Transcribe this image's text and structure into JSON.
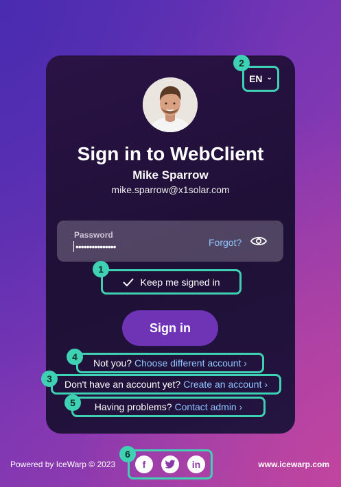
{
  "language": {
    "code": "EN"
  },
  "markers": [
    "1",
    "2",
    "3",
    "4",
    "5",
    "6"
  ],
  "heading": {
    "title": "Sign in to WebClient"
  },
  "user": {
    "name": "Mike Sparrow",
    "email": "mike.sparrow@x1solar.com"
  },
  "password": {
    "label": "Password",
    "masked_value": "•••••••••••••••",
    "forgot": "Forgot?"
  },
  "keep_signed_in": {
    "label": "Keep me signed in"
  },
  "sign_in_button": "Sign in",
  "not_you": {
    "text": "Not you?",
    "link": "Choose different account ›"
  },
  "no_account": {
    "text": "Don't have an account yet?",
    "link": "Create an account ›"
  },
  "problems": {
    "text": "Having problems?",
    "link": "Contact admin ›"
  },
  "footer": {
    "powered_by": "Powered by IceWarp © 2023",
    "website": "www.icewarp.com"
  },
  "social": {
    "facebook": "f",
    "linkedin": "in"
  },
  "colors": {
    "highlight": "#3fd1b3",
    "link": "#8ec5ff",
    "button": "#6f33b5"
  }
}
